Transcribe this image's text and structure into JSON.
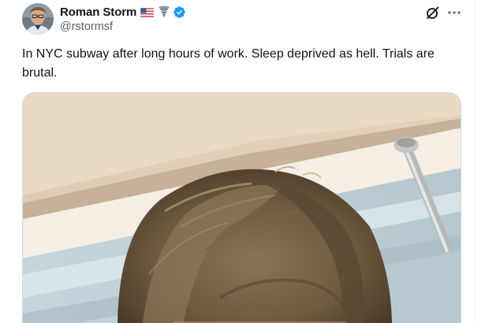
{
  "tweet": {
    "author": {
      "display_name": "Roman Storm",
      "handle": "@rstormsf",
      "verified": true,
      "name_emojis": [
        "us-flag",
        "tornado"
      ],
      "avatar": "profile-photo"
    },
    "text": "In NYC subway after long hours of work. Sleep deprived as hell. Trials are brutal.",
    "actions": {
      "grok_icon": "slashed-circle-icon",
      "more_icon": "more-dots-icon"
    },
    "media": {
      "type": "photo",
      "subject": "selfie-on-subway"
    }
  },
  "colors": {
    "text_primary": "#0f1419",
    "text_secondary": "#536471",
    "verified_blue": "#1d9bf0",
    "border": "#cfd9de"
  }
}
